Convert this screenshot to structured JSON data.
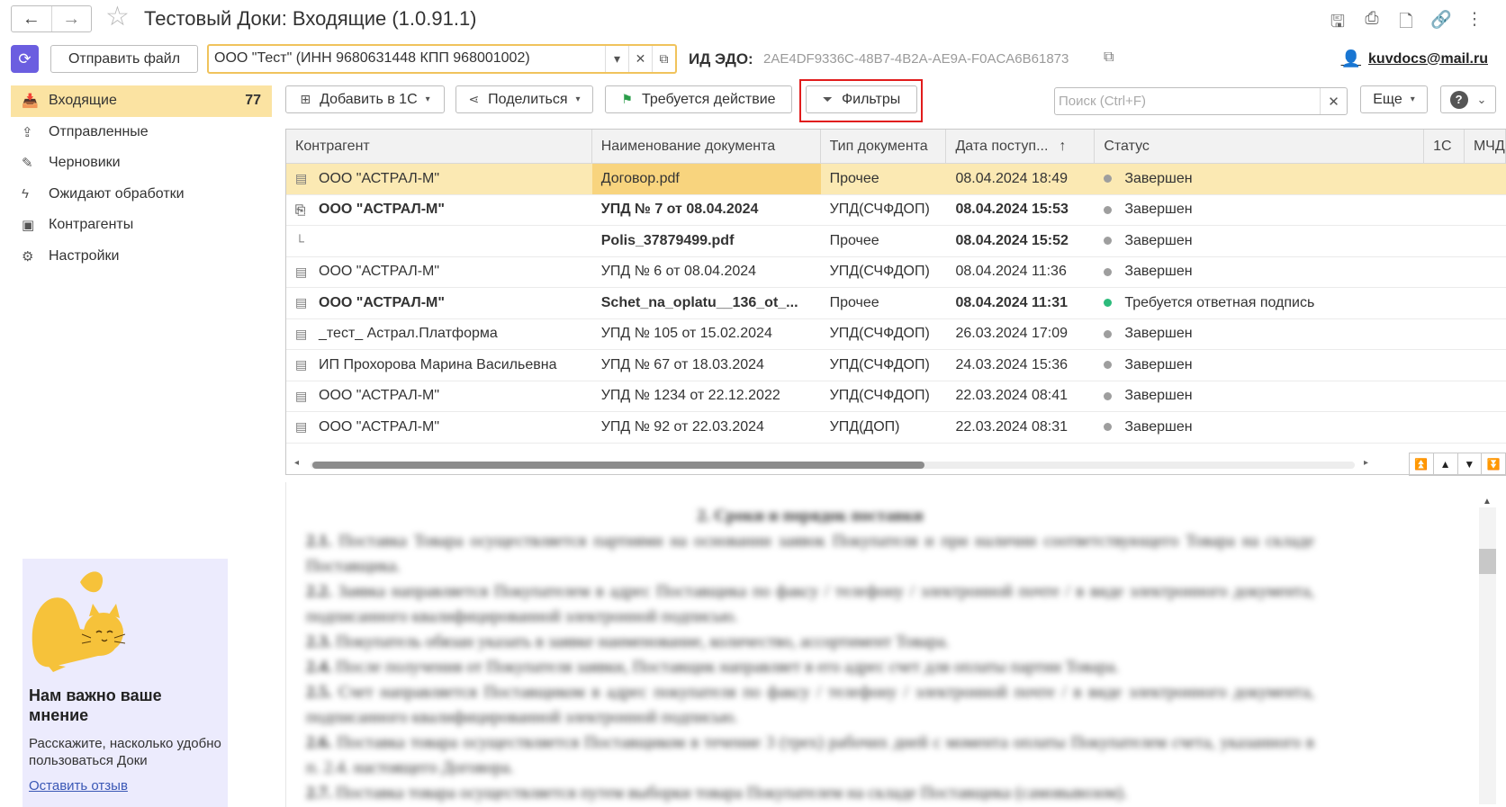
{
  "window": {
    "title": "Тестовый Доки: Входящие (1.0.91.1)",
    "back_icon": "←",
    "forward_icon": "→",
    "star_icon": "☆",
    "title_icons": [
      "save-icon",
      "print-icon",
      "preview-icon",
      "link-icon",
      "more-vert-icon"
    ]
  },
  "header": {
    "send_file_label": "Отправить файл",
    "org_value": "ООО \"Тест\" (ИНН 9680631448 КПП 968001002)",
    "edo_label": "ИД ЭДО:",
    "edo_value": "2AE4DF9336C-48B7-4B2A-AE9A-F0ACA6B61873",
    "user_email": "kuvdocs@mail.ru"
  },
  "sidebar": {
    "items": [
      {
        "label": "Входящие",
        "count": "77",
        "icon": "inbox-icon"
      },
      {
        "label": "Отправленные",
        "icon": "sent-icon"
      },
      {
        "label": "Черновики",
        "icon": "pencil-icon"
      },
      {
        "label": "Ожидают обработки",
        "icon": "lightning-icon"
      },
      {
        "label": "Контрагенты",
        "icon": "contacts-icon"
      },
      {
        "label": "Настройки",
        "icon": "gear-icon"
      }
    ]
  },
  "feedback": {
    "title": "Нам важно ваше мнение",
    "text": "Расскажите, насколько удобно пользоваться Доки",
    "link": "Оставить отзыв"
  },
  "toolbar": {
    "add_label": "Добавить в 1С",
    "share_label": "Поделиться",
    "action_label": "Требуется действие",
    "filter_label": "Фильтры",
    "search_placeholder": "Поиск (Ctrl+F)",
    "more_label": "Еще"
  },
  "table": {
    "columns": [
      "Контрагент",
      "Наименование документа",
      "Тип документа",
      "Дата поступ...",
      "Статус",
      "1С",
      "МЧД"
    ],
    "rows": [
      {
        "contractor": "ООО \"АСТРАЛ-М\"",
        "name": "Договор.pdf",
        "type": "Прочее",
        "date": "08.04.2024 18:49",
        "status": "Завершен",
        "status_color": "#9e9e9e",
        "bold": false,
        "selected": true,
        "icon": "document-icon"
      },
      {
        "contractor": "ООО \"АСТРАЛ-М\"",
        "name": "УПД № 7 от 08.04.2024",
        "type": "УПД(СЧФДОП)",
        "date": "08.04.2024 15:53",
        "status": "Завершен",
        "status_color": "#9e9e9e",
        "bold": true,
        "selected": false,
        "icon": "package-icon"
      },
      {
        "contractor": "",
        "name": "Polis_37879499.pdf",
        "type": "Прочее",
        "date": "08.04.2024 15:52",
        "status": "Завершен",
        "status_color": "#9e9e9e",
        "bold": true,
        "selected": false,
        "icon": "child-icon"
      },
      {
        "contractor": "ООО \"АСТРАЛ-М\"",
        "name": "УПД № 6 от 08.04.2024",
        "type": "УПД(СЧФДОП)",
        "date": "08.04.2024 11:36",
        "status": "Завершен",
        "status_color": "#9e9e9e",
        "bold": false,
        "selected": false,
        "icon": "document-icon"
      },
      {
        "contractor": "ООО \"АСТРАЛ-М\"",
        "name": "Schet_na_oplatu__136_ot_...",
        "type": "Прочее",
        "date": "08.04.2024 11:31",
        "status": "Требуется ответная подпись",
        "status_color": "#2dbb7c",
        "bold": true,
        "selected": false,
        "icon": "document-icon"
      },
      {
        "contractor": "_тест_ Астрал.Платформа",
        "name": "УПД № 105 от 15.02.2024",
        "type": "УПД(СЧФДОП)",
        "date": "26.03.2024 17:09",
        "status": "Завершен",
        "status_color": "#9e9e9e",
        "bold": false,
        "selected": false,
        "icon": "document-icon"
      },
      {
        "contractor": "ИП Прохорова Марина Васильевна",
        "name": "УПД № 67 от 18.03.2024",
        "type": "УПД(СЧФДОП)",
        "date": "24.03.2024 15:36",
        "status": "Завершен",
        "status_color": "#9e9e9e",
        "bold": false,
        "selected": false,
        "icon": "document-icon"
      },
      {
        "contractor": "ООО \"АСТРАЛ-М\"",
        "name": "УПД № 1234 от 22.12.2022",
        "type": "УПД(СЧФДОП)",
        "date": "22.03.2024 08:41",
        "status": "Завершен",
        "status_color": "#9e9e9e",
        "bold": false,
        "selected": false,
        "icon": "document-icon"
      },
      {
        "contractor": "ООО \"АСТРАЛ-М\"",
        "name": "УПД № 92 от 22.03.2024",
        "type": "УПД(ДОП)",
        "date": "22.03.2024 08:31",
        "status": "Завершен",
        "status_color": "#9e9e9e",
        "bold": false,
        "selected": false,
        "icon": "document-icon"
      }
    ]
  },
  "preview": {
    "heading": "2. Сроки и порядок поставки",
    "paragraphs": [
      {
        "num": "2.1.",
        "text": "Поставка Товара осуществляется партиями на основании заявок Покупателя и при наличии соответствующего Товара на складе Поставщика."
      },
      {
        "num": "2.2.",
        "text": "Заявка направляется Покупателем в адрес Поставщика по факсу / телефону / электронной почте / в виде электронного документа, подписанного квалифицированной электронной подписью."
      },
      {
        "num": "2.3.",
        "text": "Покупатель обязан указать в заявке наименование, количество, ассортимент Товара."
      },
      {
        "num": "2.4.",
        "text": "После получения от Покупателя заявки, Поставщик направляет в его адрес счет для оплаты партии Товара."
      },
      {
        "num": "2.5.",
        "text": "Счет направляется Поставщиком в адрес покупателя по факсу / телефону / электронной почте / в виде электронного документа, подписанного квалифицированной электронной подписью."
      },
      {
        "num": "2.6.",
        "text": "Поставка товара осуществляется Поставщиком в течение 3 (трех) рабочих дней с момента оплаты Покупателем счета, указанного в п. 2.4. настоящего Договора."
      },
      {
        "num": "2.7.",
        "text": "Поставка товара осуществляется путем выборки товара Покупателем на складе Поставщика (самовывозом)."
      }
    ]
  },
  "colors": {
    "accent": "#fbe3a2",
    "selected_row": "#fbe9b3",
    "highlight_border": "#e11c1c",
    "brand": "#6b5ee0"
  }
}
